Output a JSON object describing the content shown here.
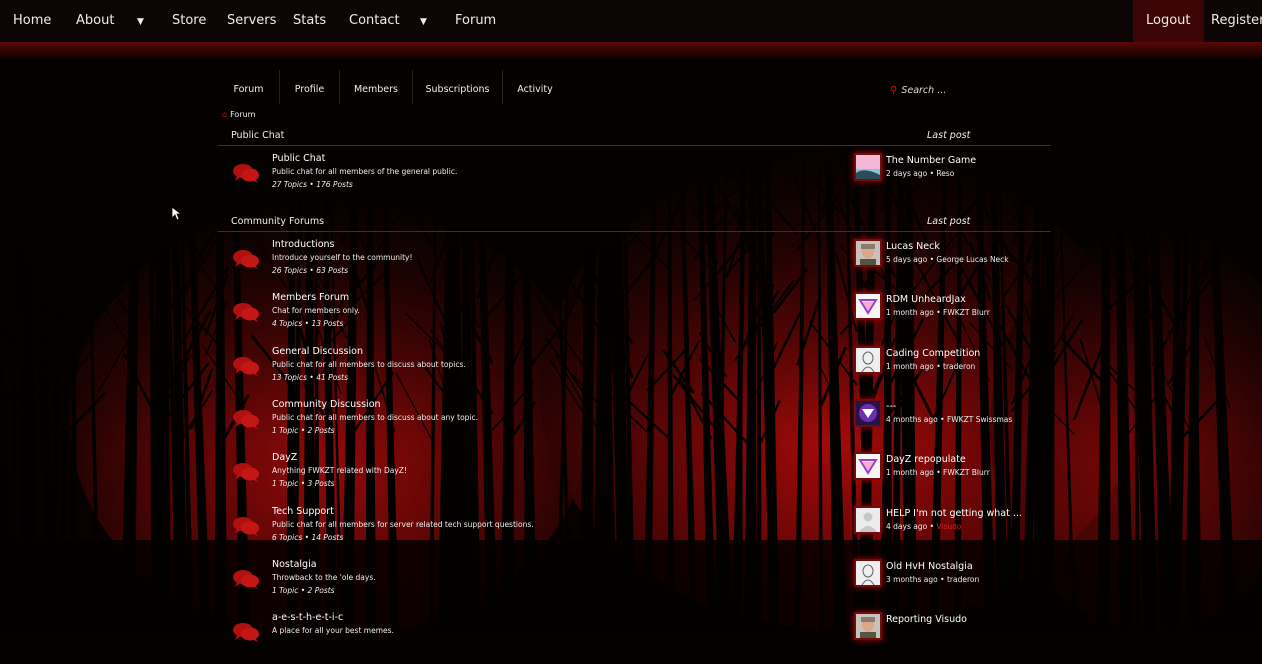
{
  "topnav": {
    "items": [
      "Home",
      "About",
      "Store",
      "Servers",
      "Stats",
      "Contact",
      "Forum"
    ],
    "logout": "Logout",
    "register": "Register"
  },
  "subnav": {
    "tabs": [
      "Forum",
      "Profile",
      "Members",
      "Subscriptions",
      "Activity"
    ],
    "search_placeholder": "Search ..."
  },
  "breadcrumb": "Forum",
  "sections": [
    {
      "title": "Public Chat",
      "last_post_label": "Last post",
      "forums": [
        {
          "name": "Public Chat",
          "desc": "Public chat for all members of the general public.",
          "stats": "27 Topics • 176 Posts",
          "last_title": "The Number Game",
          "last_time": "2 days ago",
          "last_user": "Reso",
          "avatar": "pink-landscape"
        }
      ]
    },
    {
      "title": "Community Forums",
      "last_post_label": "Last post",
      "forums": [
        {
          "name": "Introductions",
          "desc": "Introduce yourself to the community!",
          "stats": "26 Topics • 63 Posts",
          "last_title": "Lucas Neck",
          "last_time": "5 days ago",
          "last_user": "George Lucas Neck",
          "avatar": "face-photo"
        },
        {
          "name": "Members Forum",
          "desc": "Chat for members only.",
          "stats": "4 Topics • 13 Posts",
          "last_title": "RDM UnheardJax",
          "last_time": "1 month ago",
          "last_user": "FWKZT Blurr",
          "avatar": "triangle-logo"
        },
        {
          "name": "General Discussion",
          "desc": "Public chat for all members to discuss about topics.",
          "stats": "13 Topics • 41 Posts",
          "last_title": "Cading Competition",
          "last_time": "1 month ago",
          "last_user": "traderon",
          "avatar": "statue-sketch"
        },
        {
          "name": "Community Discussion",
          "desc": "Public chat for all members to discuss about any topic.",
          "stats": "1 Topic • 2 Posts",
          "last_title": "---",
          "last_time": "4 months ago",
          "last_user": "FWKZT Swissmas",
          "avatar": "purple-logo"
        },
        {
          "name": "DayZ",
          "desc": "Anything FWKZT related with DayZ!",
          "stats": "1 Topic • 3 Posts",
          "last_title": "DayZ repopulate",
          "last_time": "1 month ago",
          "last_user": "FWKZT Blurr",
          "avatar": "triangle-logo"
        },
        {
          "name": "Tech Support",
          "desc": "Public chat for all members for server related tech support questions.",
          "stats": "6 Topics • 14 Posts",
          "last_title": "HELP I'm not getting what ...",
          "last_time": "4 days ago",
          "last_user": "Visudo",
          "last_user_highlight": true,
          "avatar": "default-user"
        },
        {
          "name": "Nostalgia",
          "desc": "Throwback to the 'ole days.",
          "stats": "1 Topic • 2 Posts",
          "last_title": "Old HvH Nostalgia",
          "last_time": "3 months ago",
          "last_user": "traderon",
          "avatar": "statue-sketch"
        },
        {
          "name": "a-e-s-t-h-e-t-i-c",
          "desc": "A place for all your best memes.",
          "stats": "",
          "last_title": "Reporting Visudo",
          "last_time": "",
          "last_user": "",
          "avatar": "face-photo"
        }
      ]
    }
  ],
  "colors": {
    "accent": "#c81414",
    "nav_bg": "#0d0505",
    "logout_bg": "#3b0505"
  }
}
